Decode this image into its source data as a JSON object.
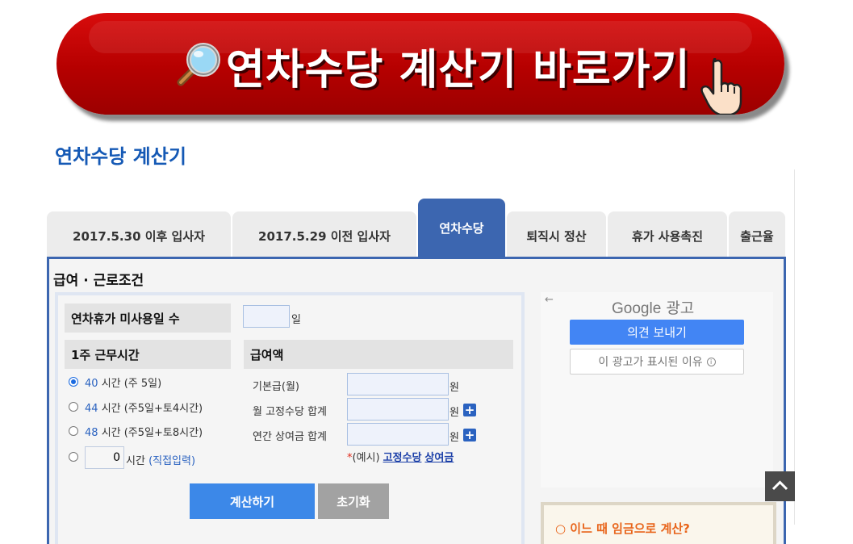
{
  "banner": {
    "text": "연차수당 계산기 바로가기"
  },
  "page_title": "연차수당 계산기",
  "tabs": [
    {
      "label": "2017.5.30 이후 입사자"
    },
    {
      "label": "2017.5.29 이전 입사자"
    },
    {
      "label": "연차수당",
      "active": true
    },
    {
      "label": "퇴직시 정산"
    },
    {
      "label": "휴가 사용촉진"
    },
    {
      "label": "출근율"
    }
  ],
  "form": {
    "section_title": "급여 · 근로조건",
    "unused_days": {
      "label": "연차휴가 미사용일 수",
      "value": "",
      "unit": "일"
    },
    "weekly_hours": {
      "label": "1주 근무시간",
      "options": [
        {
          "num": "40",
          "text": "시간 (주 5일)"
        },
        {
          "num": "44",
          "text": "시간 (주5일+토4시간)"
        },
        {
          "num": "48",
          "text": "시간 (주5일+토8시간)"
        }
      ],
      "custom": {
        "value": "0",
        "unit": "시간",
        "note": "(직접입력)"
      }
    },
    "salary": {
      "label": "급여액",
      "rows": [
        {
          "label": "기본급(월)",
          "value": "",
          "unit": "원"
        },
        {
          "label": "월 고정수당 합계",
          "value": "",
          "unit": "원"
        },
        {
          "label": "연간 상여금 합계",
          "value": "",
          "unit": "원"
        }
      ],
      "example": {
        "star": "*",
        "text": "(예시)",
        "link1": "고정수당",
        "link2": "상여금"
      }
    },
    "buttons": {
      "calculate": "계산하기",
      "reset": "초기화"
    }
  },
  "ad": {
    "back": "←",
    "brand": "Google",
    "title_suffix": "광고",
    "feedback": "의견 보내기",
    "why": "이 광고가 표시된 이유"
  },
  "info_box": {
    "text": "○ 이느 때 임금으로 계산?"
  },
  "colors": {
    "banner_red": "#c00000",
    "title_blue": "#1559b5",
    "tab_active": "#3c66b0",
    "primary_button": "#3c88e8",
    "ad_button": "#4285f4"
  }
}
